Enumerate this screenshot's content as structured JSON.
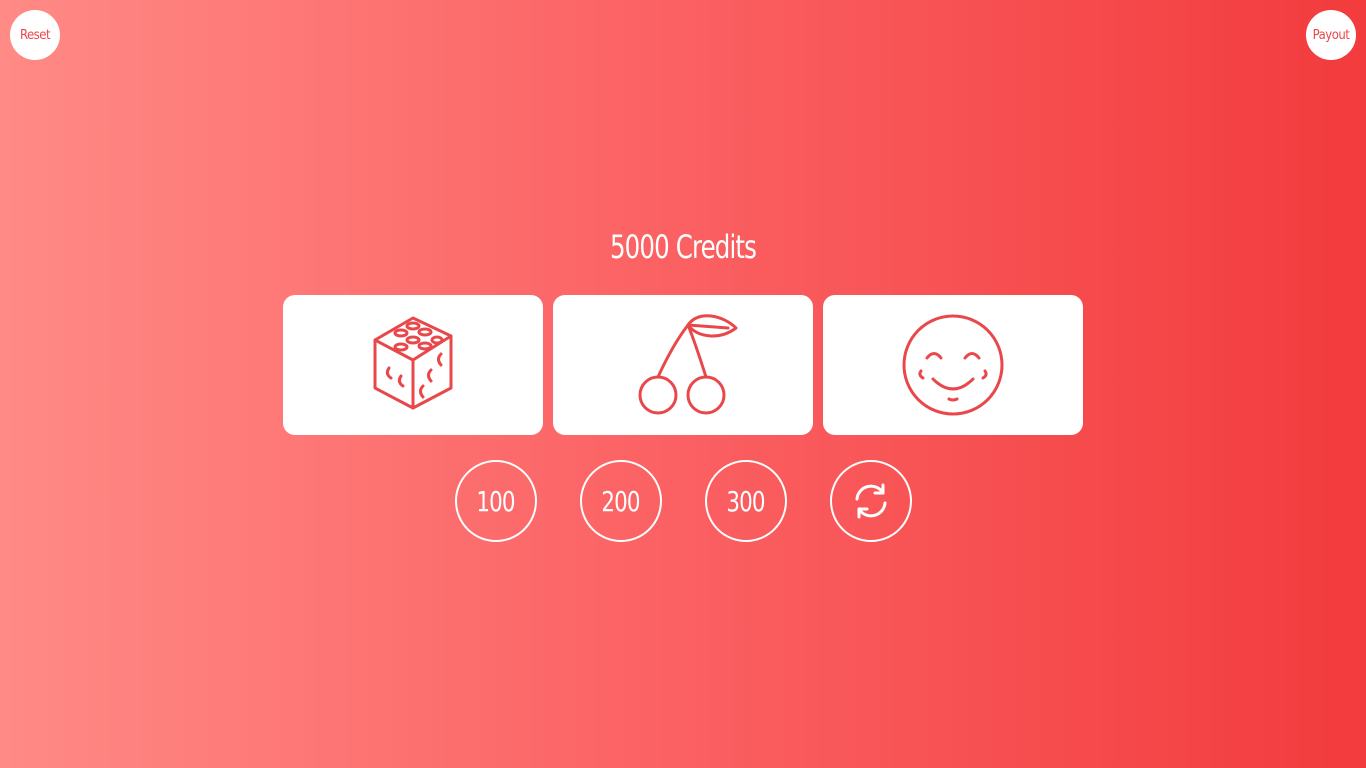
{
  "header": {
    "reset_label": "Reset",
    "payout_label": "Payout"
  },
  "credits": {
    "text": "5000 Credits"
  },
  "reels": [
    {
      "icon": "dice-icon"
    },
    {
      "icon": "cherry-icon"
    },
    {
      "icon": "smiley-face-icon"
    }
  ],
  "controls": {
    "bet_100_label": "100",
    "bet_200_label": "200",
    "bet_300_label": "300",
    "spin_icon": "refresh-icon"
  },
  "colors": {
    "icon_stroke": "#e9484b",
    "background_start": "#ff8a86",
    "background_end": "#f23b3d"
  }
}
